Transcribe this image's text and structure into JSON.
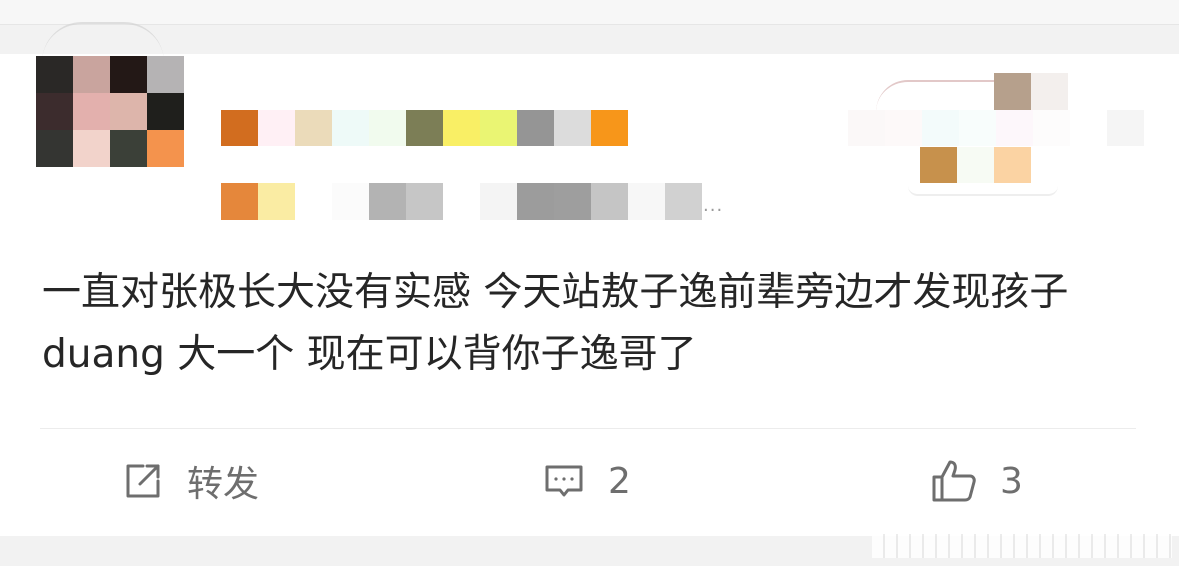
{
  "post": {
    "text": "一直对张极长大没有实感 今天站敖子逸前辈旁边才发现孩子 duang 大一个 现在可以背你子逸哥了"
  },
  "actions": {
    "repost_label": "转发",
    "comment_count": "2",
    "like_count": "3"
  },
  "user": {
    "meta_ellipsis": "..."
  },
  "icons": {
    "repost": "share-edit-icon",
    "comment": "comment-icon",
    "like": "thumbs-up-icon"
  },
  "colors": {
    "text": "#262626",
    "action_text": "#6e6e6e",
    "background": "#f2f2f2",
    "card": "#ffffff"
  },
  "mosaic": {
    "avatar": [
      "#2a2826",
      "#c9a49e",
      "#231816",
      "#b5b3b4",
      "#3c2c2d",
      "#e3b0ad",
      "#ddb5ab",
      "#1f1f1c",
      "#343532",
      "#f2d3cb",
      "#3b4038",
      "#f4934d"
    ],
    "name": [
      "#d26d1f",
      "#fff0f5",
      "#ebdbba",
      "#eefaf8",
      "#f1fbee",
      "#7c7e56",
      "#f9ef65",
      "#eaf573",
      "#959595",
      "#dcdcdc",
      "#f7961a"
    ],
    "meta": [
      "#e5873b",
      "#faeca3",
      "#ffffff",
      "#fbfbfb",
      "#b3b3b3",
      "#c6c6c6",
      "#ffffff",
      "#f4f4f4",
      "#9c9c9c",
      "#9e9e9e",
      "#c5c5c5",
      "#f7f7f7",
      "#d1d1d1"
    ],
    "badge_top": [
      "#b6a08c",
      "#f3efed"
    ],
    "badge_row1": [
      "#fbf8f8",
      "#fdf9f9",
      "#f3fbfb",
      "#f8fdfc",
      "#fdf7fb",
      "#fdfcfc",
      "#ffffff",
      "#f5f5f5"
    ],
    "badge_row2": [
      "#c7914c",
      "#f7fbf4",
      "#fbd3a3"
    ]
  }
}
